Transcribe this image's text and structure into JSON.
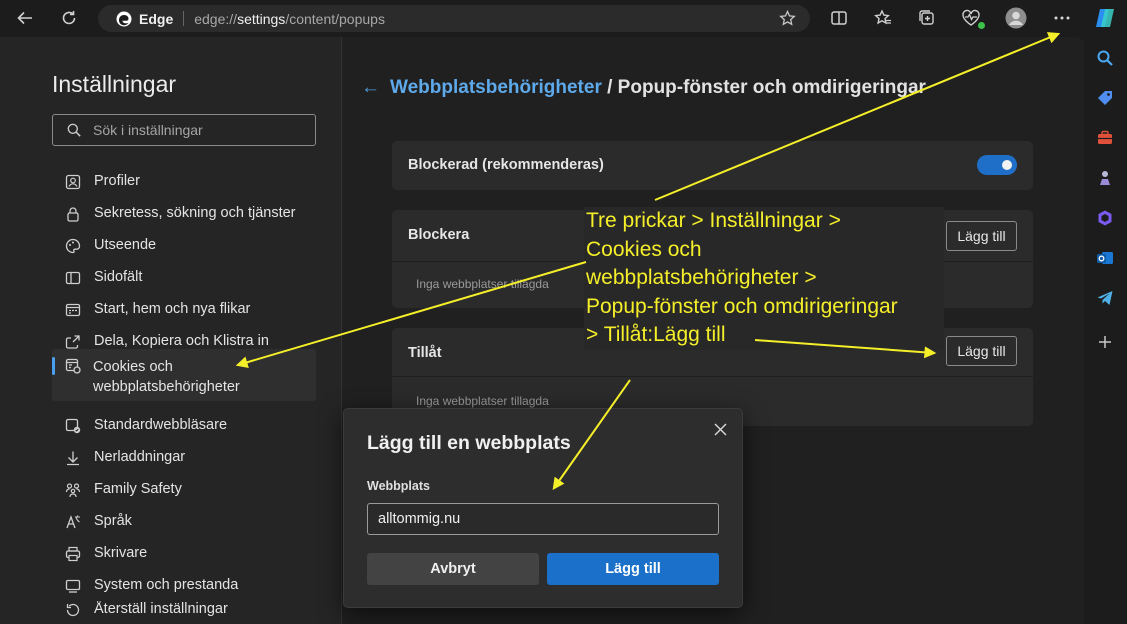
{
  "browser": {
    "app_name": "Edge",
    "url_prefix": "edge://",
    "url_host": "settings",
    "url_path": "/content/popups",
    "toolbar_icons": [
      "back-icon",
      "refresh-icon",
      "favorite-star-icon",
      "split-screen-icon",
      "favorites-icon",
      "collections-icon",
      "browser-essentials-icon",
      "profile-icon",
      "more-options-icon",
      "copilot-icon"
    ],
    "side_icons": [
      "search-icon",
      "shopping-tag-icon",
      "tools-icon",
      "games-icon",
      "microsoft365-icon",
      "outlook-icon",
      "telegram-icon",
      "add-icon"
    ]
  },
  "settings_nav": {
    "title": "Inställningar",
    "search_placeholder": "Sök i inställningar",
    "items": [
      {
        "label": "Profiler",
        "icon": "profile-icon"
      },
      {
        "label": "Sekretess, sökning och tjänster",
        "icon": "lock-icon"
      },
      {
        "label": "Utseende",
        "icon": "palette-icon"
      },
      {
        "label": "Sidofält",
        "icon": "sidebar-icon"
      },
      {
        "label": "Start, hem och nya flikar",
        "icon": "home-tabs-icon"
      },
      {
        "label": "Dela, Kopiera och Klistra in",
        "icon": "share-icon"
      },
      {
        "label": "Cookies och webbplatsbehörigheter",
        "icon": "cookies-icon",
        "active": true
      },
      {
        "label": "Standardwebbläsare",
        "icon": "default-browser-icon"
      },
      {
        "label": "Nerladdningar",
        "icon": "download-icon"
      },
      {
        "label": "Family Safety",
        "icon": "family-icon"
      },
      {
        "label": "Språk",
        "icon": "language-icon"
      },
      {
        "label": "Skrivare",
        "icon": "printer-icon"
      },
      {
        "label": "System och prestanda",
        "icon": "system-icon"
      },
      {
        "label": "Återställ inställningar",
        "icon": "reset-icon"
      }
    ]
  },
  "page": {
    "breadcrumb_link": "Webbplatsbehörigheter",
    "breadcrumb_rest": " / Popup-fönster och omdirigeringar",
    "blocked_label": "Blockerad (rekommenderas)",
    "blocked_toggle_on": true,
    "block_section": {
      "label": "Blockera",
      "button": "Lägg till",
      "empty": "Inga webbplatser tillagda"
    },
    "allow_section": {
      "label": "Tillåt",
      "button": "Lägg till",
      "empty": "Inga webbplatser tillagda"
    }
  },
  "annotation": {
    "lines": [
      "Tre prickar > Inställningar >",
      "Cookies och",
      "webbplatsbehörigheter >",
      "Popup-fönster och omdirigeringar",
      "> Tillåt:Lägg till"
    ],
    "color": "#f5ef2a"
  },
  "dialog": {
    "title": "Lägg till en webbplats",
    "field_label": "Webbplats",
    "field_value": "alltommig.nu",
    "cancel": "Avbryt",
    "confirm": "Lägg till"
  },
  "colors": {
    "accent": "#1b70c9",
    "link": "#5ea9ea",
    "annotation": "#f5ef2a"
  }
}
